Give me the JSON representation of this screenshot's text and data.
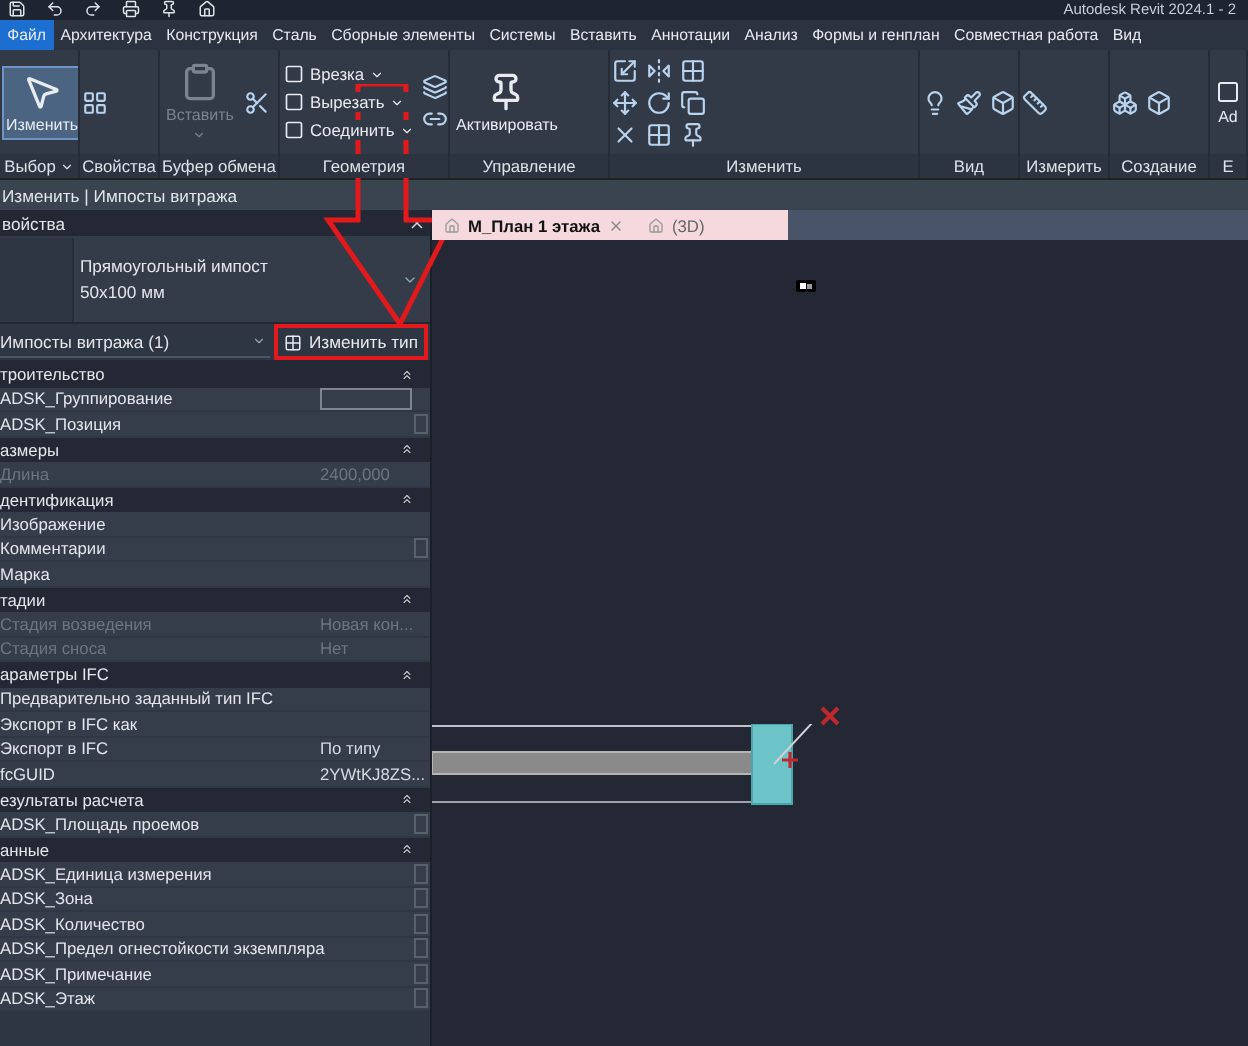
{
  "title_bar": {
    "title": "Autodesk Revit 2024.1 - 2"
  },
  "menu_tabs": [
    {
      "label": "Файл",
      "selected": true
    },
    {
      "label": "Архитектура",
      "selected": false
    },
    {
      "label": "Конструкция",
      "selected": false
    },
    {
      "label": "Сталь",
      "selected": false
    },
    {
      "label": "Сборные элементы",
      "selected": false
    },
    {
      "label": "Системы",
      "selected": false
    },
    {
      "label": "Вставить",
      "selected": false
    },
    {
      "label": "Аннотации",
      "selected": false
    },
    {
      "label": "Анализ",
      "selected": false
    },
    {
      "label": "Формы и генплан",
      "selected": false
    },
    {
      "label": "Совместная работа",
      "selected": false
    },
    {
      "label": "Вид",
      "selected": false
    }
  ],
  "ribbon": [
    {
      "label": "Выбор",
      "dropdown": true,
      "tools": [
        {
          "label": "Изменить",
          "kind": "large",
          "active": true,
          "disabled": false,
          "dropdown": false
        }
      ]
    },
    {
      "label": "Свойства",
      "dropdown": false
    },
    {
      "label": "Буфер обмена",
      "dropdown": false,
      "tools": [
        {
          "label": "Вставить",
          "kind": "large",
          "active": false,
          "disabled": true,
          "dropdown": true
        }
      ]
    },
    {
      "label": "Геометрия",
      "dropdown": false,
      "tools": [
        {
          "label": "Врезка",
          "kind": "small",
          "active": false,
          "disabled": false,
          "dropdown": true
        },
        {
          "label": "Вырезать",
          "kind": "small",
          "active": false,
          "disabled": false,
          "dropdown": true
        },
        {
          "label": "Соединить",
          "kind": "small",
          "active": false,
          "disabled": false,
          "dropdown": true
        }
      ]
    },
    {
      "label": "Управление",
      "dropdown": false,
      "tools": [
        {
          "label": "Активировать",
          "kind": "large",
          "active": false,
          "disabled": false,
          "dropdown": false
        }
      ]
    },
    {
      "label": "Изменить",
      "dropdown": false
    },
    {
      "label": "Вид",
      "dropdown": false
    },
    {
      "label": "Измерить",
      "dropdown": false
    },
    {
      "label": "Создание",
      "dropdown": false
    },
    {
      "label": "E",
      "dropdown": false,
      "tools": [
        {
          "label": "Ad",
          "kind": "large",
          "active": false,
          "disabled": false,
          "dropdown": false
        }
      ]
    }
  ],
  "context_bar": {
    "text": "Изменить | Импосты витража"
  },
  "properties": {
    "title": "войства",
    "type_selector": {
      "name": "Прямоугольный импост",
      "size": "50x100 мм"
    },
    "instance_filter": "Импосты витража (1)",
    "edit_type_button": {
      "label": "Изменить тип",
      "highlighted": true
    },
    "groups": [
      {
        "name": "троительство",
        "expanded": true,
        "rows": [
          {
            "name": "ADSK_Группирование",
            "kind": "field",
            "disabled": false
          },
          {
            "name": "ADSK_Позиция",
            "kind": "check",
            "checked": false,
            "disabled": false
          }
        ]
      },
      {
        "name": "азмеры",
        "expanded": true,
        "rows": [
          {
            "name": "Длина",
            "kind": "text",
            "value": "2400,000",
            "disabled": true
          }
        ]
      },
      {
        "name": "дентификация",
        "expanded": true,
        "rows": [
          {
            "name": "Изображение",
            "kind": "blank",
            "disabled": false
          },
          {
            "name": "Комментарии",
            "kind": "check",
            "checked": false,
            "disabled": false
          },
          {
            "name": "Марка",
            "kind": "blank",
            "disabled": false
          }
        ]
      },
      {
        "name": "тадии",
        "expanded": true,
        "rows": [
          {
            "name": "Стадия возведения",
            "kind": "text",
            "value": "Новая кон...",
            "disabled": true
          },
          {
            "name": "Стадия сноса",
            "kind": "text",
            "value": "Нет",
            "disabled": true
          }
        ]
      },
      {
        "name": "араметры IFC",
        "expanded": true,
        "rows": [
          {
            "name": "Предварительно заданный тип IFC",
            "kind": "blank",
            "disabled": false
          },
          {
            "name": "Экспорт в IFC как",
            "kind": "blank",
            "disabled": false
          },
          {
            "name": "Экспорт в IFC",
            "kind": "text",
            "value": "По типу",
            "disabled": false
          },
          {
            "name": "fcGUID",
            "kind": "text",
            "value": "2YWtKJ8ZS...",
            "disabled": false
          }
        ]
      },
      {
        "name": "езультаты расчета",
        "expanded": true,
        "rows": [
          {
            "name": "ADSK_Площадь проемов",
            "kind": "check",
            "checked": false,
            "disabled": false
          }
        ]
      },
      {
        "name": "анные",
        "expanded": true,
        "rows": [
          {
            "name": "ADSK_Единица измерения",
            "kind": "check",
            "checked": false,
            "disabled": false
          },
          {
            "name": "ADSK_Зона",
            "kind": "check",
            "checked": false,
            "disabled": false
          },
          {
            "name": "ADSK_Количество",
            "kind": "check",
            "checked": false,
            "disabled": false
          },
          {
            "name": "ADSK_Предел огнестойкости экземпляра",
            "kind": "check",
            "checked": false,
            "disabled": false
          },
          {
            "name": "ADSK_Примечание",
            "kind": "check",
            "checked": false,
            "disabled": false
          },
          {
            "name": "ADSK_Этаж",
            "kind": "check",
            "checked": false,
            "disabled": false
          }
        ]
      }
    ]
  },
  "view_tabs": [
    {
      "label": "М_План 1 этажа",
      "selected": true,
      "closable": true
    },
    {
      "label": "(3D)",
      "selected": false,
      "closable": false
    }
  ]
}
